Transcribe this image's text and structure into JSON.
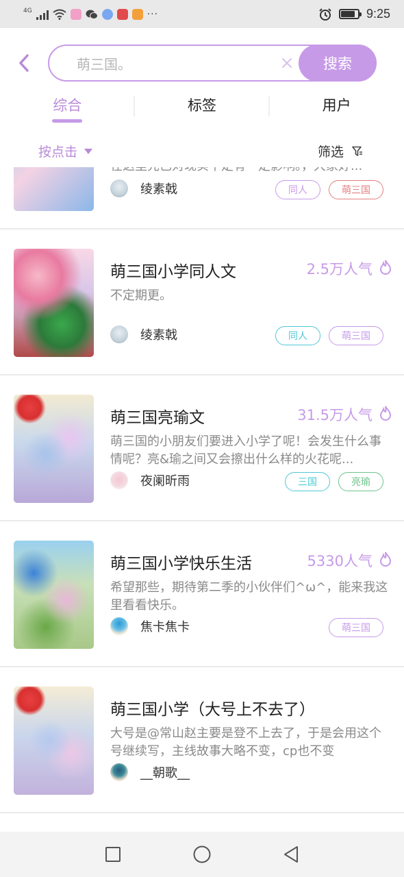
{
  "status": {
    "network": "4G",
    "time": "9:25",
    "more": "···"
  },
  "search": {
    "placeholder": "萌三国。",
    "button": "搜索"
  },
  "tabs": [
    {
      "label": "综合",
      "active": true
    },
    {
      "label": "标签",
      "active": false
    },
    {
      "label": "用户",
      "active": false
    }
  ],
  "filters": {
    "sort_label": "按点击",
    "filter_label": "筛选"
  },
  "results": [
    {
      "title": "",
      "popularity": "",
      "desc": "在这里先已对现实平定有一定影响。，大家好...",
      "author": "绫素戟",
      "tags": [
        {
          "label": "同人",
          "color": "#c79ae8"
        },
        {
          "label": "萌三国",
          "color": "#e57f7f"
        }
      ]
    },
    {
      "title": "萌三国小学同人文",
      "popularity": "2.5万人气",
      "desc": "不定期更。",
      "author": "绫素戟",
      "tags": [
        {
          "label": "同人",
          "color": "#4fc8d6"
        },
        {
          "label": "萌三国",
          "color": "#c79ae8"
        }
      ]
    },
    {
      "title": "萌三国亮瑜文",
      "popularity": "31.5万人气",
      "desc": "萌三国的小朋友们要进入小学了呢！会发生什么事情呢？亮&瑜之间又会擦出什么样的火花呢...",
      "author": "夜阑昕雨",
      "tags": [
        {
          "label": "三国",
          "color": "#4fc8d6"
        },
        {
          "label": "亮瑜",
          "color": "#6cc48a"
        }
      ]
    },
    {
      "title": "萌三国小学快乐生活",
      "popularity": "5330人气",
      "desc": "希望那些，期待第二季的小伙伴们^ω^，能来我这里看看快乐。",
      "author": "焦卡焦卡",
      "tags": [
        {
          "label": "萌三国",
          "color": "#c79ae8"
        }
      ]
    },
    {
      "title": "萌三国小学（大号上不去了）",
      "popularity": "",
      "desc": "大号是@常山赵主要是登不上去了，于是会用这个号继续写，主线故事大略不变，cp也不变",
      "author": "__朝歌__",
      "tags": []
    }
  ],
  "colors": {
    "accent": "#c79ae8",
    "accent_text": "#b98ad8"
  }
}
